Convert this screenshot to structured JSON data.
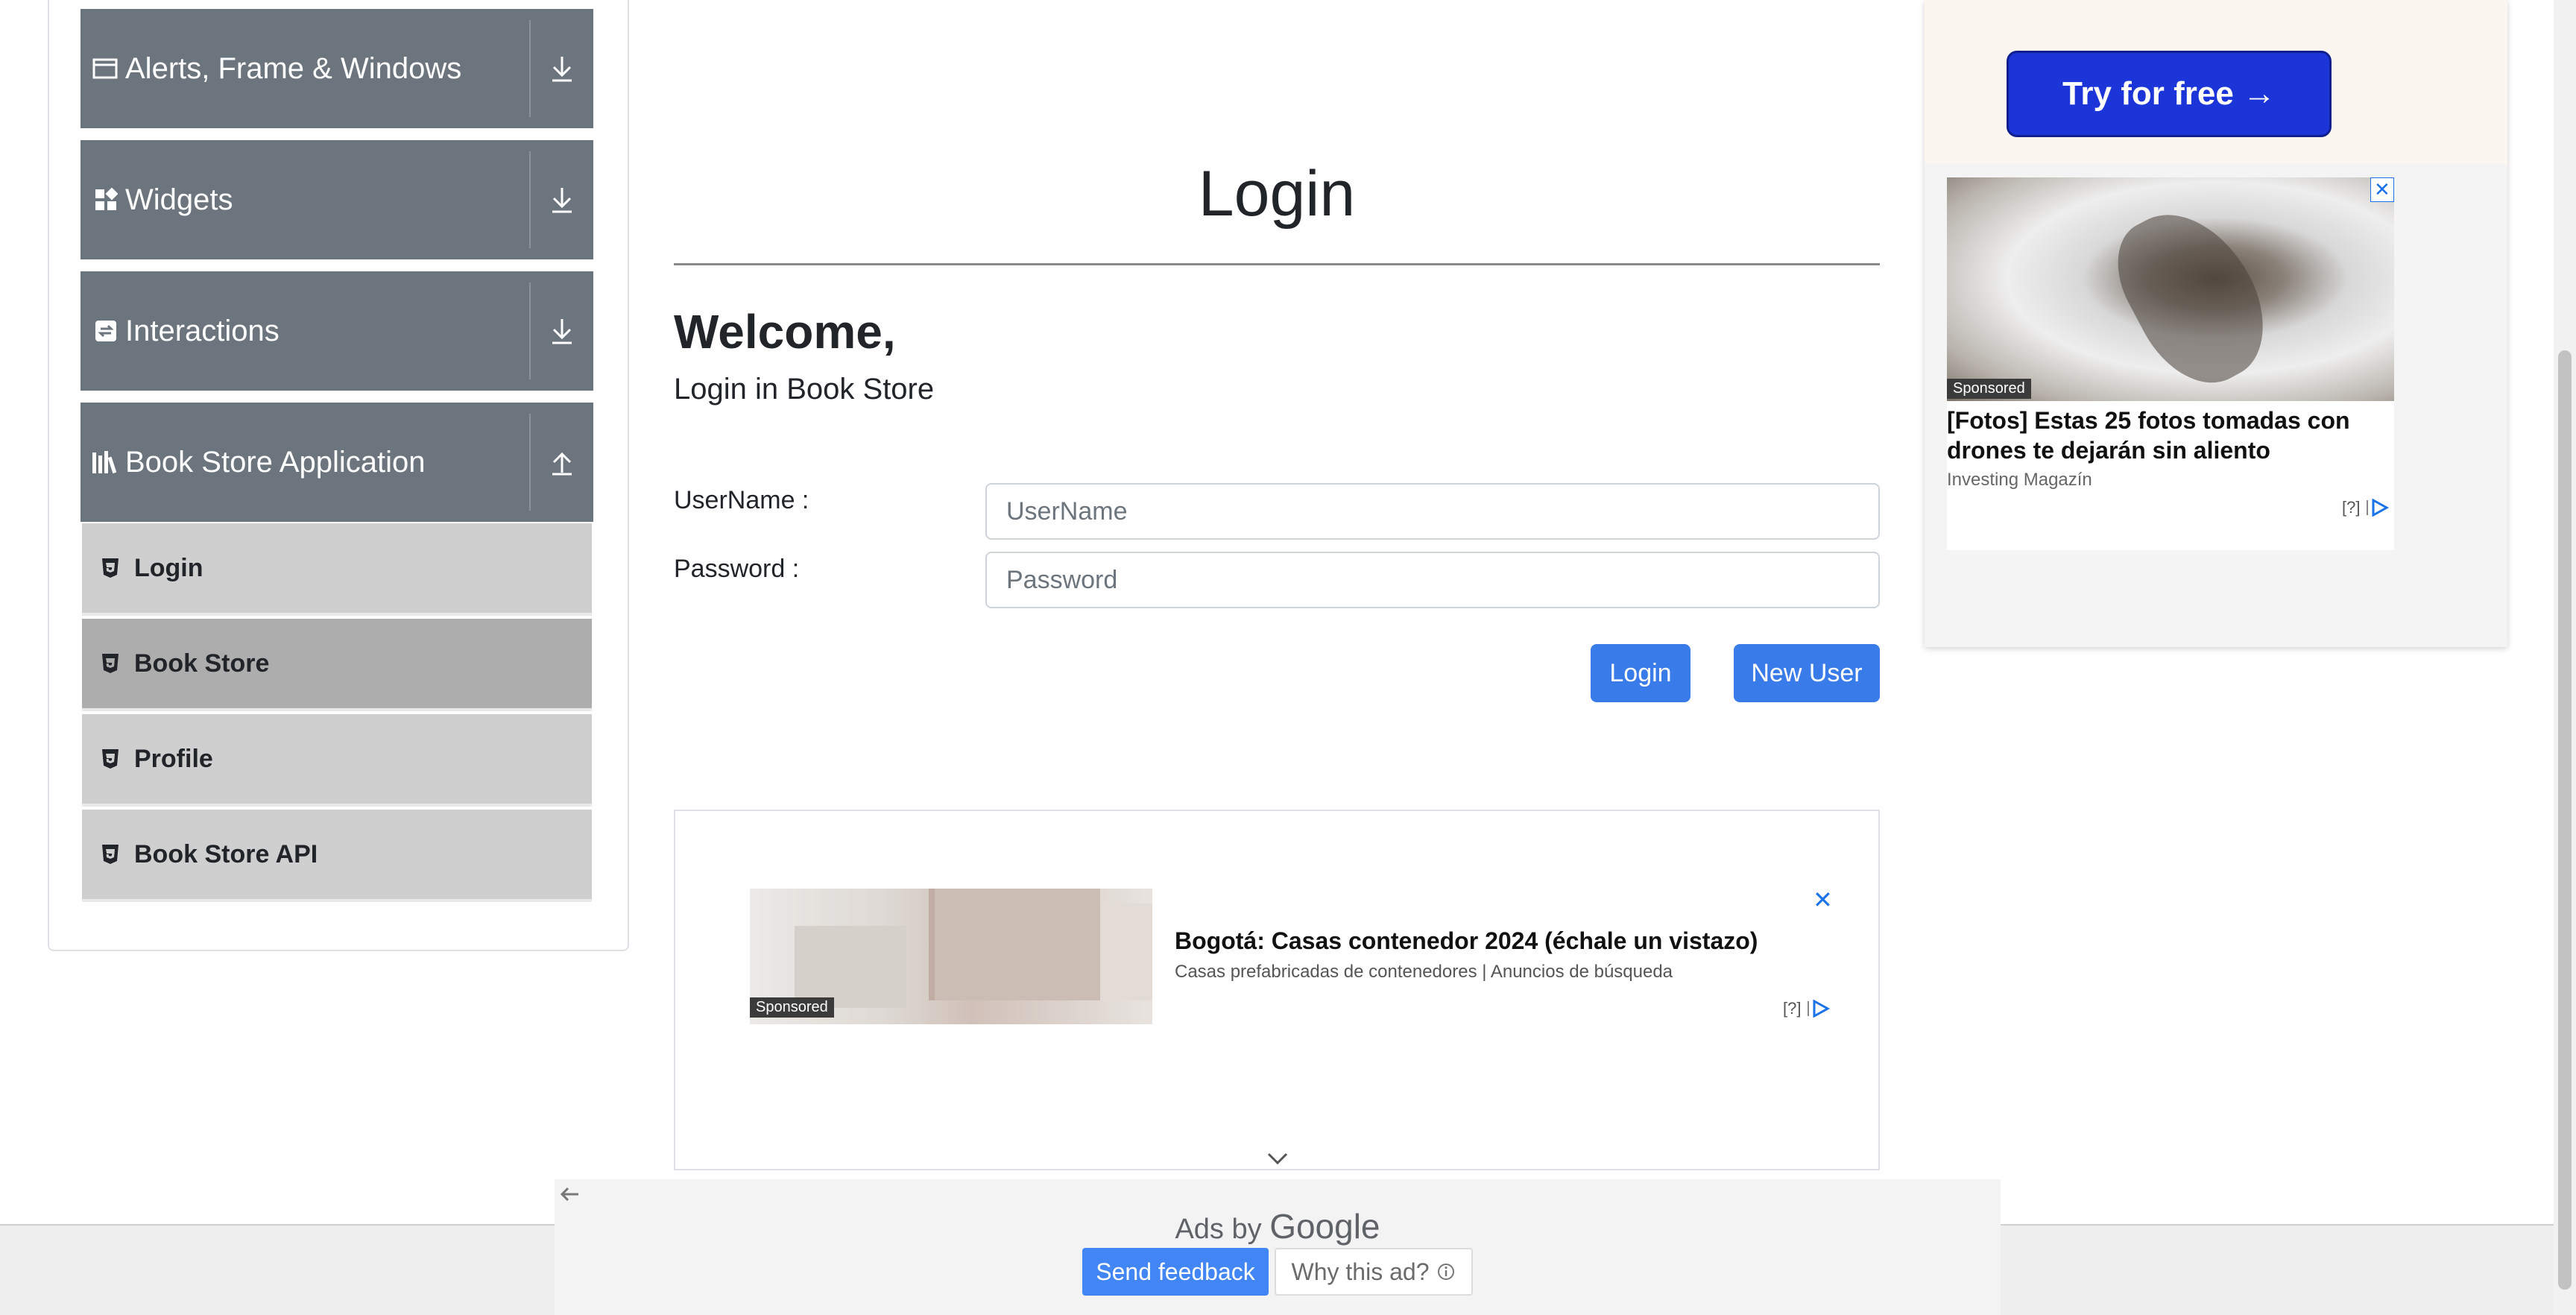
{
  "sidebar": {
    "groups": [
      {
        "label": "Alerts, Frame & Windows",
        "icon": "window-icon",
        "toggle": "download-arrow-icon"
      },
      {
        "label": "Widgets",
        "icon": "widgets-icon",
        "toggle": "download-arrow-icon"
      },
      {
        "label": "Interactions",
        "icon": "interactions-icon",
        "toggle": "download-arrow-icon"
      },
      {
        "label": "Book Store Application",
        "icon": "books-icon",
        "toggle": "upload-arrow-icon"
      }
    ],
    "items": [
      {
        "label": "Login",
        "active": false
      },
      {
        "label": "Book Store",
        "active": true
      },
      {
        "label": "Profile",
        "active": false
      },
      {
        "label": "Book Store API",
        "active": false
      }
    ]
  },
  "main": {
    "title": "Login",
    "welcome": "Welcome,",
    "subtitle": "Login in Book Store",
    "username_label": "UserName :",
    "username_placeholder": "UserName",
    "password_label": "Password :",
    "password_placeholder": "Password",
    "login_button": "Login",
    "new_user_button": "New User"
  },
  "bottom_ad": {
    "title": "Bogotá: Casas contenedor 2024 (échale un vistazo)",
    "description": "Casas prefabricadas de contenedores | Anuncios de búsqueda",
    "sponsored": "Sponsored",
    "info": "[?]",
    "close": "✕"
  },
  "right_ad": {
    "cta": "Try for free →",
    "sponsored": "Sponsored",
    "title": "[Fotos] Estas 25 fotos tomadas con drones te dejarán sin aliento",
    "source": "Investing Magazín",
    "info": "[?]",
    "close": "✕"
  },
  "ads_by_google": {
    "prefix": "Ads by",
    "brand": "Google",
    "send_feedback": "Send feedback",
    "why_this_ad": "Why this ad?"
  },
  "colors": {
    "sidebar_header": "#6c757d",
    "sidebar_item": "#cfcfcf",
    "sidebar_item_active": "#adadad",
    "primary": "#3a7bea",
    "try_button": "#1c35d8",
    "feedback_button": "#4285f4"
  }
}
